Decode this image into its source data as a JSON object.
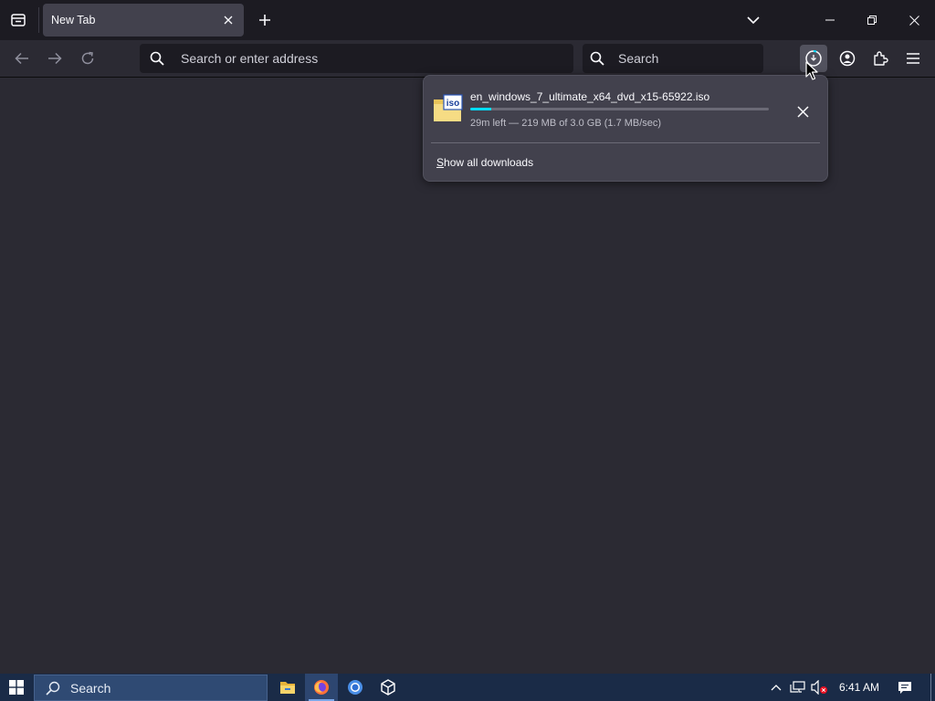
{
  "tabs": [
    {
      "title": "New Tab"
    }
  ],
  "navbar": {
    "urlbar_placeholder": "Search or enter address",
    "searchbar_placeholder": "Search"
  },
  "downloads_panel": {
    "items": [
      {
        "filename": "en_windows_7_ultimate_x64_dvd_x15-65922.iso",
        "file_icon_label": "iso",
        "status": "29m left — 219 MB of 3.0 GB (1.7 MB/sec)",
        "progress_fraction": 0.07
      }
    ],
    "show_all_prefix": "S",
    "show_all_rest": "how all downloads"
  },
  "taskbar": {
    "search_placeholder": "Search",
    "apps": [
      "file-explorer-icon",
      "firefox-icon",
      "chrome-icon",
      "package-icon"
    ],
    "active_app": "firefox-icon",
    "clock": "6:41 AM"
  },
  "colors": {
    "toolbar_bg": "#2b2a33",
    "tabstrip_bg": "#1c1b22",
    "panel_bg": "#42414d",
    "progress_accent": "#00ddff",
    "taskbar_bg": "#1a2b47"
  }
}
